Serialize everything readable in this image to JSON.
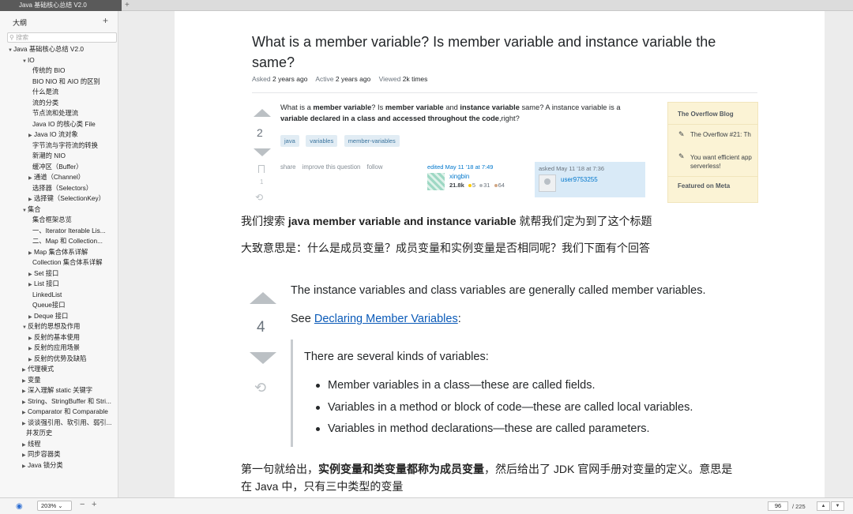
{
  "tab": {
    "title": "Java 基础核心总结 V2.0",
    "add": "+"
  },
  "sidebar": {
    "title": "大纲",
    "add": "+",
    "search_placeholder": "搜索",
    "nodes": [
      {
        "label": "Java 基础核心总结 V2.0",
        "level": 0,
        "tri": "▼"
      },
      {
        "label": "IO",
        "level": 1,
        "tri": "▼"
      },
      {
        "label": "传统的 BIO",
        "level": 2,
        "tri": ""
      },
      {
        "label": "BIO NIO 和 AIO 的区别",
        "level": 2,
        "tri": ""
      },
      {
        "label": "什么是流",
        "level": 2,
        "tri": ""
      },
      {
        "label": "流的分类",
        "level": 2,
        "tri": ""
      },
      {
        "label": "节点流和处理流",
        "level": 2,
        "tri": ""
      },
      {
        "label": "Java IO 的核心类 File",
        "level": 2,
        "tri": ""
      },
      {
        "label": "Java IO 流对象",
        "level": 2,
        "tri": "▶"
      },
      {
        "label": "字节流与字符流的转换",
        "level": 2,
        "tri": ""
      },
      {
        "label": "新潮的 NIO",
        "level": 2,
        "tri": ""
      },
      {
        "label": "缓冲区（Buffer）",
        "level": 2,
        "tri": ""
      },
      {
        "label": "通道（Channel）",
        "level": 2,
        "tri": "▶"
      },
      {
        "label": "选择器（Selectors）",
        "level": 2,
        "tri": ""
      },
      {
        "label": "选择键（SelectionKey）",
        "level": 2,
        "tri": "▶"
      },
      {
        "label": "集合",
        "level": 1,
        "tri": "▼"
      },
      {
        "label": "集合框架总览",
        "level": 2,
        "tri": ""
      },
      {
        "label": "一、Iterator  Iterable Lis...",
        "level": 2,
        "tri": ""
      },
      {
        "label": "二、Map 和 Collection...",
        "level": 2,
        "tri": ""
      },
      {
        "label": "Map 集合体系详解",
        "level": 2,
        "tri": "▶"
      },
      {
        "label": "Collection 集合体系详解",
        "level": 2,
        "tri": ""
      },
      {
        "label": "Set 接口",
        "level": 2,
        "tri": "▶"
      },
      {
        "label": "List 接口",
        "level": 2,
        "tri": "▶"
      },
      {
        "label": "LinkedList",
        "level": 2,
        "tri": ""
      },
      {
        "label": "Queue接口",
        "level": 2,
        "tri": ""
      },
      {
        "label": "Deque 接口",
        "level": 2,
        "tri": "▶"
      },
      {
        "label": "反射的思想及作用",
        "level": 1,
        "tri": "▼"
      },
      {
        "label": "反射的基本使用",
        "level": 2,
        "tri": "▶"
      },
      {
        "label": "反射的应用场景",
        "level": 2,
        "tri": "▶"
      },
      {
        "label": "反射的优势及缺陷",
        "level": 2,
        "tri": "▶"
      },
      {
        "label": "代理模式",
        "level": 1,
        "tri": "▶"
      },
      {
        "label": "变量",
        "level": 1,
        "tri": "▶"
      },
      {
        "label": "深入理解 static 关键字",
        "level": 1,
        "tri": "▶"
      },
      {
        "label": "String、StringBuffer 和 Stri...",
        "level": 1,
        "tri": "▶"
      },
      {
        "label": "Comparator 和 Comparable",
        "level": 1,
        "tri": "▶"
      },
      {
        "label": "谈谈强引用、软引用、弱引...",
        "level": 1,
        "tri": "▶"
      },
      {
        "label": "并发历史",
        "level": 1,
        "tri": ""
      },
      {
        "label": "线程",
        "level": 1,
        "tri": "▶"
      },
      {
        "label": "同步容器类",
        "level": 1,
        "tri": "▶"
      },
      {
        "label": "Java 锁分类",
        "level": 1,
        "tri": "▶"
      }
    ]
  },
  "question": {
    "title": "What is a member variable? Is member variable and instance variable the same?",
    "asked_label": "Asked",
    "asked_value": "2 years ago",
    "active_label": "Active",
    "active_value": "2 years ago",
    "viewed_label": "Viewed",
    "viewed_value": "2k times",
    "votes": "2",
    "favorites": "1",
    "body_1": "What is a ",
    "body_2": "member variable",
    "body_3": "? Is ",
    "body_4": "member variable",
    "body_5": " and ",
    "body_6": "instance variable",
    "body_7": " same? A instance variable is a ",
    "body_8": "variable declared in a class and accessed throughout the code",
    "body_9": ",right?",
    "tags": [
      "java",
      "variables",
      "member-variables"
    ],
    "links": [
      "share",
      "improve this question",
      "follow"
    ],
    "editor_label": "edited May 11 '18 at 7:49",
    "editor_name": "xingbin",
    "editor_rep": "21.8k",
    "editor_gold": "5",
    "editor_silver": "31",
    "editor_bronze": "64",
    "asker_label": "asked May 11 '18 at 7:36",
    "asker_name": "user9753255"
  },
  "blog": {
    "header": "The Overflow Blog",
    "item1": "The Overflow #21: Th",
    "item2": "You want efficient app serverless!",
    "footer": "Featured on Meta"
  },
  "cn": {
    "line1_a": "我们搜索 ",
    "line1_b": "java member variable and instance variable",
    "line1_c": " 就帮我们定为到了这个标题",
    "line2": "大致意思是：什么是成员变量？成员变量和实例变量是否相同呢？我们下面有个回答",
    "line3_a": "第一句就给出，",
    "line3_b": "实例变量和类变量都称为成员变量",
    "line3_c": "，然后给出了 JDK 官网手册对变量的定义。意思是",
    "line4": "在 Java 中，只有三中类型的变量"
  },
  "answer": {
    "votes": "4",
    "line1": "The instance variables and class variables are generally called member variables.",
    "line2_a": "See ",
    "line2_link": "Declaring Member Variables",
    "line2_b": ":",
    "quote": "There are several kinds of variables:",
    "bullets": [
      "Member variables in a class—these are called fields.",
      "Variables in a method or block of code—these are called local variables.",
      "Variables in method declarations—these are called parameters."
    ]
  },
  "bottombar": {
    "zoom": "203%",
    "zoom_minus": "−",
    "zoom_plus": "+",
    "page": "96",
    "total": "/ 225",
    "up": "▲",
    "down": "▼"
  },
  "colors": {
    "link": "#0a5ab8",
    "tag_bg": "#e1ecf4",
    "blog_bg": "#fbf3d5",
    "gold": "#ffcc01",
    "silver": "#b4b8bc",
    "bronze": "#d1a684"
  }
}
